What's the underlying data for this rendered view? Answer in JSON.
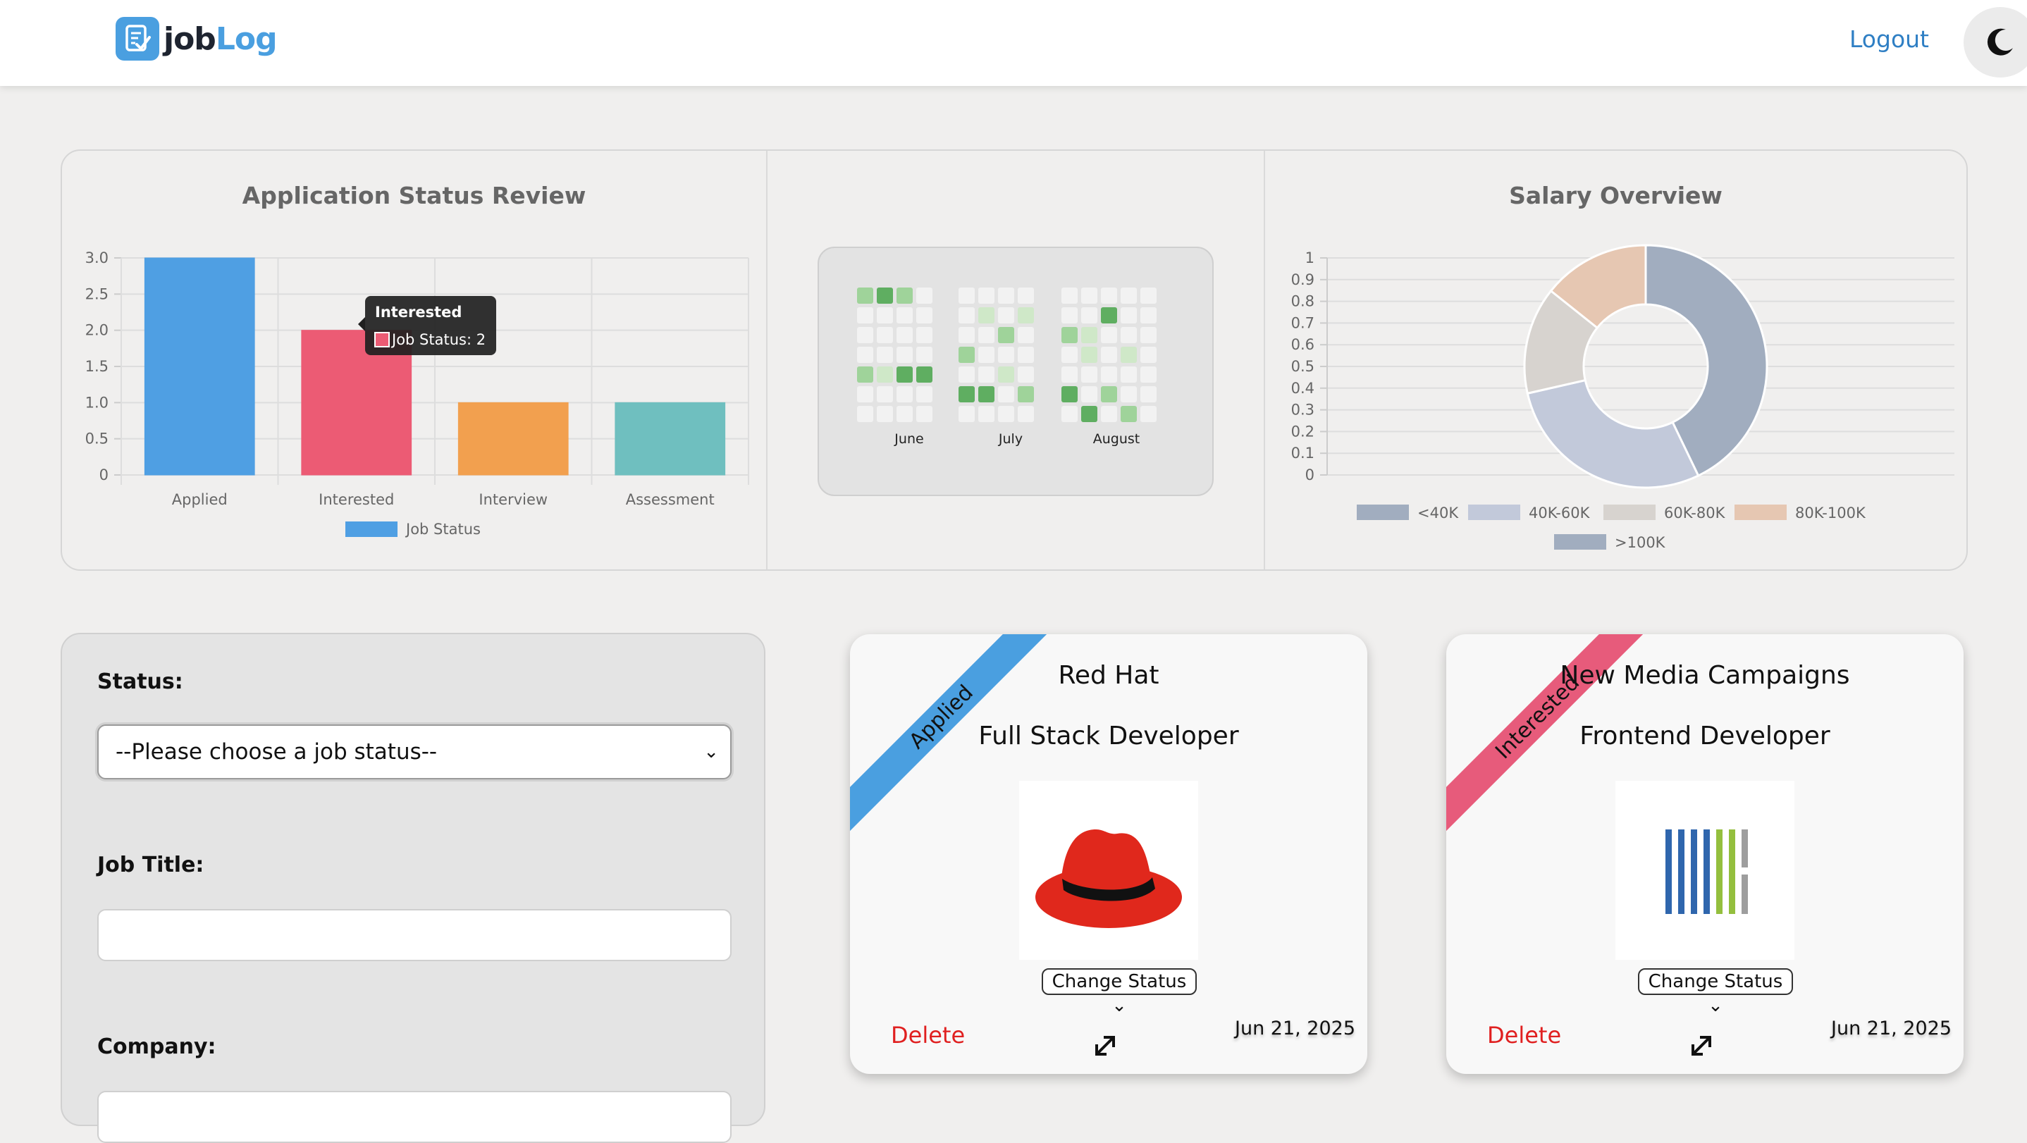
{
  "nav": {
    "logo_part1": "job",
    "logo_part2": "Log",
    "logout_label": "Logout"
  },
  "stats": {
    "bar_chart": {
      "title": "Application Status Review",
      "legend_label": "Job Status",
      "tooltip_title": "Interested",
      "tooltip_text": "Job Status: 2",
      "y_ticks": [
        "3.0",
        "2.5",
        "2.0",
        "1.5",
        "1.0",
        "0.5",
        "0"
      ]
    },
    "heatmap": {
      "months": [
        "June",
        "July",
        "August"
      ]
    },
    "donut_chart": {
      "title": "Salary Overview",
      "y_ticks": [
        "1",
        "0.9",
        "0.8",
        "0.7",
        "0.6",
        "0.5",
        "0.4",
        "0.3",
        "0.2",
        "0.1",
        "0"
      ],
      "legend": [
        "<40K",
        "40K-60K",
        "60K-80K",
        "80K-100K",
        ">100K"
      ]
    }
  },
  "chart_data": [
    {
      "type": "bar",
      "title": "Application Status Review",
      "categories": [
        "Applied",
        "Interested",
        "Interview",
        "Assessment"
      ],
      "series": [
        {
          "name": "Job Status",
          "values": [
            3,
            2,
            1,
            1
          ]
        }
      ],
      "colors": [
        "#4f9fe3",
        "#ec5b74",
        "#f2a04f",
        "#6fbfbf"
      ],
      "ylim": [
        0,
        3
      ],
      "grid": true,
      "legend_position": "bottom"
    },
    {
      "type": "pie",
      "title": "Salary Overview",
      "categories": [
        "<40K",
        "40K-60K",
        "60K-80K",
        "80K-100K",
        ">100K"
      ],
      "values": [
        3,
        2,
        1,
        1,
        0
      ],
      "colors": [
        "#a1adbf",
        "#c2c9da",
        "#d7d3cf",
        "#e6c7b2",
        "#a1adbf"
      ],
      "legend_position": "bottom"
    }
  ],
  "filter": {
    "status_label": "Status:",
    "status_value": "--Please choose a job status--",
    "job_title_label": "Job Title:",
    "company_label": "Company:"
  },
  "cards": [
    {
      "ribbon": "Applied",
      "company": "Red Hat",
      "title": "Full Stack Developer",
      "status_button": "Change Status",
      "delete_label": "Delete",
      "date": "Jun 21, 2025"
    },
    {
      "ribbon": "Interested",
      "company": "New Media Campaigns",
      "title": "Frontend Developer",
      "status_button": "Change Status",
      "delete_label": "Delete",
      "date": "Jun 21, 2025"
    }
  ],
  "colors": {
    "brand": "#4a9fe0",
    "delete": "#e02020",
    "applied": "#4a9fe0",
    "interested": "#e75b7b"
  }
}
